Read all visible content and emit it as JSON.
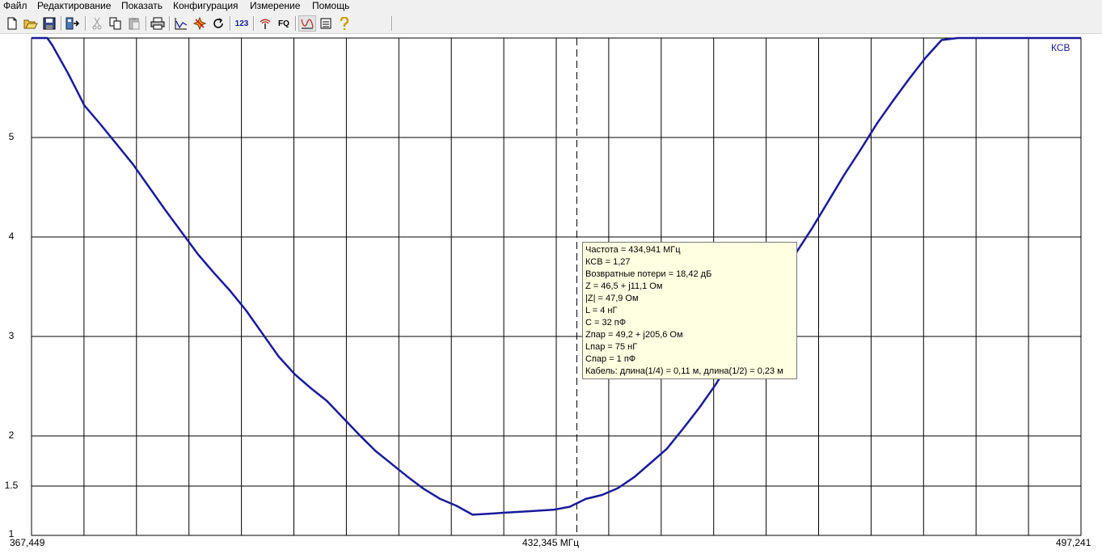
{
  "menu": {
    "items": [
      {
        "label": "Файл"
      },
      {
        "label": "Редактирование"
      },
      {
        "label": "Показать"
      },
      {
        "label": "Конфигурация"
      },
      {
        "label": "Измерение"
      },
      {
        "label": "Помощь"
      }
    ]
  },
  "toolbar": {
    "buttons": [
      {
        "icon": "new-file-icon"
      },
      {
        "icon": "open-folder-icon"
      },
      {
        "icon": "save-icon"
      },
      {
        "icon": "export-icon"
      },
      {
        "icon": "cut-icon"
      },
      {
        "icon": "copy-icon"
      },
      {
        "icon": "paste-icon"
      },
      {
        "icon": "print-icon"
      },
      {
        "icon": "graph-icon"
      },
      {
        "icon": "marker-icon"
      },
      {
        "icon": "refresh-icon"
      },
      {
        "icon": "numbers-icon",
        "text": "123"
      },
      {
        "icon": "antenna-icon"
      },
      {
        "icon": "fq-icon",
        "text": "FQ"
      },
      {
        "icon": "swr-chart-icon"
      },
      {
        "icon": "list-icon"
      },
      {
        "icon": "help-icon"
      }
    ]
  },
  "tooltip": {
    "lines": [
      "Частота = 434,941 МГц",
      "КСВ = 1,27",
      "Возвратные потери = 18,42 дБ",
      "Z = 46,5 + j11,1 Ом",
      "|Z| = 47,9 Ом",
      "L = 4 нГ",
      "C = 32 пФ",
      "Zпар = 49,2 + j205,6 Ом",
      "Lпар = 75 нГ",
      "Спар = 1 пФ",
      "Кабель: длина(1/4) = 0,11 м, длина(1/2) = 0,23 м"
    ]
  },
  "chart_data": {
    "type": "line",
    "series": [
      {
        "name": "КСВ",
        "color": "#1a1a9a"
      }
    ],
    "x_start_label": "367,449",
    "x_center_label": "432,345 МГц",
    "x_end_label": "497,241",
    "xlim": [
      367.449,
      497.241
    ],
    "ylim": [
      1,
      6
    ],
    "y_ticks": [
      "5",
      "4",
      "3",
      "2",
      "1.5",
      "1"
    ],
    "y_tick_values": [
      5,
      4,
      3,
      2,
      1.5,
      1
    ],
    "grid": true,
    "marker_x": 434.941,
    "x": [
      367.449,
      369.4,
      370.0,
      372.0,
      374.0,
      376.0,
      378.0,
      380.0,
      382.0,
      384.0,
      386.0,
      388.0,
      390.0,
      392.0,
      394.0,
      396.0,
      398.0,
      400.0,
      402.0,
      404.0,
      406.0,
      408.0,
      410.0,
      412.0,
      414.0,
      416.0,
      418.0,
      420.0,
      422.0,
      424.0,
      426.0,
      428.0,
      430.0,
      432.0,
      434.0,
      435.0,
      436.0,
      438.0,
      440.0,
      442.0,
      444.0,
      446.0,
      448.0,
      450.0,
      452.0,
      454.0,
      456.0,
      458.0,
      460.0,
      462.0,
      464.0,
      466.0,
      468.0,
      470.0,
      472.0,
      474.0,
      476.0,
      478.0,
      480.0,
      482.0,
      484.0,
      486.0,
      486.5,
      488.0,
      490.0,
      492.0,
      494.0,
      497.241
    ],
    "y": [
      6.0,
      6.0,
      5.93,
      5.64,
      5.32,
      5.13,
      4.93,
      4.73,
      4.5,
      4.27,
      4.05,
      3.83,
      3.64,
      3.46,
      3.26,
      3.03,
      2.8,
      2.62,
      2.48,
      2.35,
      2.18,
      2.01,
      1.85,
      1.72,
      1.59,
      1.47,
      1.37,
      1.3,
      1.21,
      1.22,
      1.23,
      1.24,
      1.25,
      1.26,
      1.29,
      1.33,
      1.37,
      1.41,
      1.48,
      1.59,
      1.73,
      1.87,
      2.07,
      2.28,
      2.51,
      2.77,
      3.03,
      3.3,
      3.58,
      3.84,
      4.09,
      4.36,
      4.63,
      4.88,
      5.14,
      5.37,
      5.59,
      5.8,
      5.98,
      6.0,
      6.0,
      6.0,
      6.0,
      6.0,
      6.0,
      6.0,
      6.0,
      6.0
    ]
  }
}
